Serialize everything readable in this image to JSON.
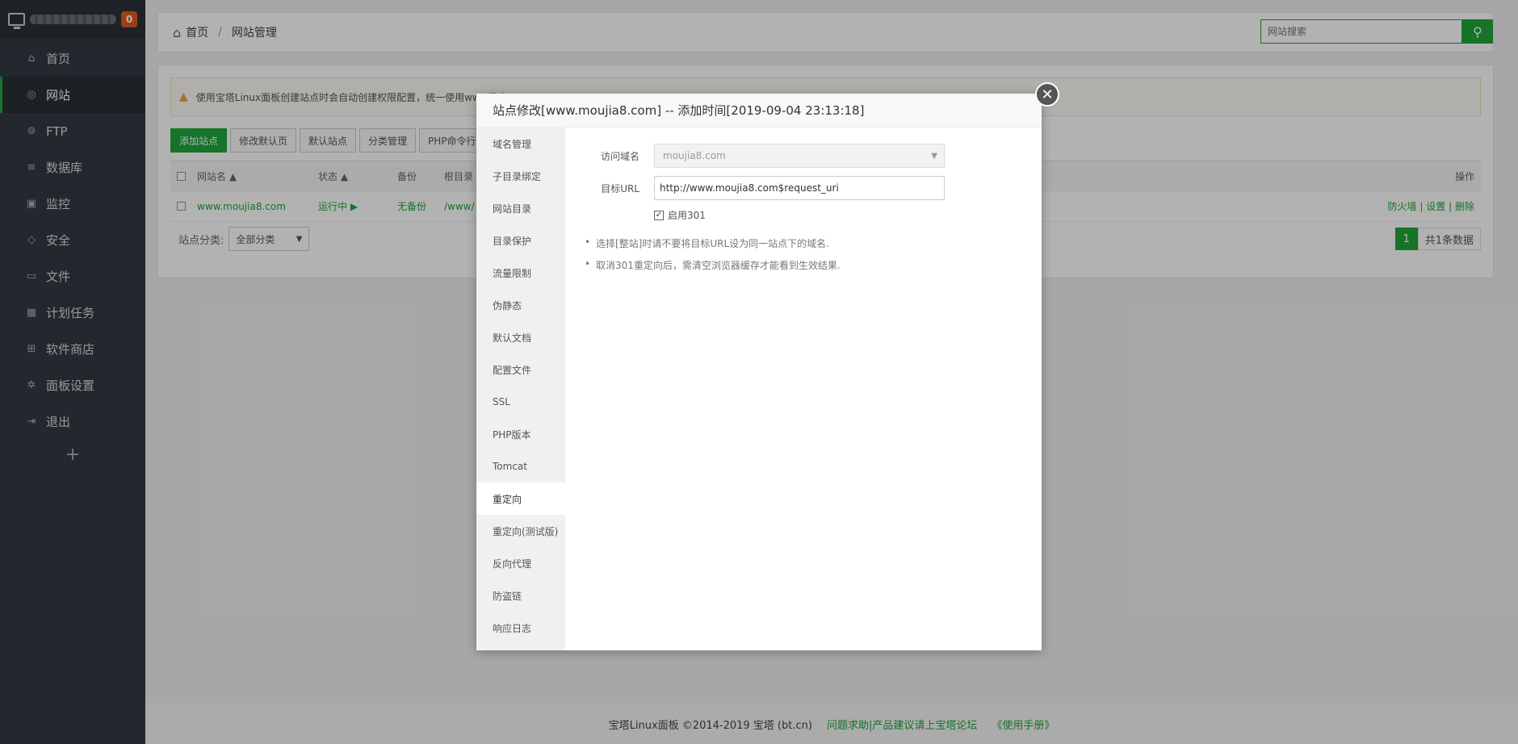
{
  "sidebar": {
    "badge": "0",
    "items": [
      {
        "label": "首页",
        "icon": "home-icon",
        "glyph": "⌂"
      },
      {
        "label": "网站",
        "icon": "globe-icon",
        "glyph": "◎"
      },
      {
        "label": "FTP",
        "icon": "ftp-icon",
        "glyph": "⊚"
      },
      {
        "label": "数据库",
        "icon": "database-icon",
        "glyph": "≡"
      },
      {
        "label": "监控",
        "icon": "monitor-icon",
        "glyph": "▣"
      },
      {
        "label": "安全",
        "icon": "shield-icon",
        "glyph": "◇"
      },
      {
        "label": "文件",
        "icon": "folder-icon",
        "glyph": "▭"
      },
      {
        "label": "计划任务",
        "icon": "calendar-icon",
        "glyph": "▦"
      },
      {
        "label": "软件商店",
        "icon": "grid-icon",
        "glyph": "⊞"
      },
      {
        "label": "面板设置",
        "icon": "gear-icon",
        "glyph": "✲"
      },
      {
        "label": "退出",
        "icon": "logout-icon",
        "glyph": "⇥"
      }
    ],
    "plus": "+"
  },
  "breadcrumb": {
    "home": "首页",
    "sep": "/",
    "current": "网站管理"
  },
  "search": {
    "placeholder": "网站搜索"
  },
  "alert": {
    "text": "使用宝塔Linux面板创建站点时会自动创建权限配置，统一使用www用户"
  },
  "toolbar": {
    "add_site": "添加站点",
    "edit_default": "修改默认页",
    "default_site": "默认站点",
    "category_mgmt": "分类管理",
    "php_cli": "PHP命令行"
  },
  "table": {
    "headers": {
      "name": "网站名 ▲",
      "status": "状态 ▲",
      "backup": "备份",
      "root": "根目录",
      "ops": "操作"
    },
    "row": {
      "name": "www.moujia8.com",
      "status": "运行中 ▶",
      "backup": "无备份",
      "root": "/www/",
      "firewall": "防火墙",
      "settings": "设置",
      "delete": "删除",
      "sep": "|"
    }
  },
  "pager": {
    "category_label": "站点分类:",
    "category_value": "全部分类",
    "page": "1",
    "total": "共1条数据"
  },
  "footer": {
    "copyright": "宝塔Linux面板 ©2014-2019 宝塔 (bt.cn)",
    "forum": "问题求助|产品建议请上宝塔论坛",
    "manual": "《使用手册》"
  },
  "modal": {
    "title": "站点修改[www.moujia8.com] -- 添加时间[2019-09-04 23:13:18]",
    "tabs": [
      "域名管理",
      "子目录绑定",
      "网站目录",
      "目录保护",
      "流量限制",
      "伪静态",
      "默认文档",
      "配置文件",
      "SSL",
      "PHP版本",
      "Tomcat",
      "重定向",
      "重定向(测试版)",
      "反向代理",
      "防盗链",
      "响应日志"
    ],
    "active_tab": "重定向",
    "domain_label": "访问域名",
    "domain_value": "moujia8.com",
    "url_label": "目标URL",
    "url_value": "http://www.moujia8.com$request_uri",
    "enable_301": "启用301",
    "tips": [
      "选择[整站]时请不要将目标URL设为同一站点下的域名.",
      "取消301重定向后，需清空浏览器缓存才能看到生效结果."
    ]
  },
  "colors": {
    "accent": "#20a53a",
    "sidebar": "#333a42",
    "badge": "#e25b1c"
  }
}
